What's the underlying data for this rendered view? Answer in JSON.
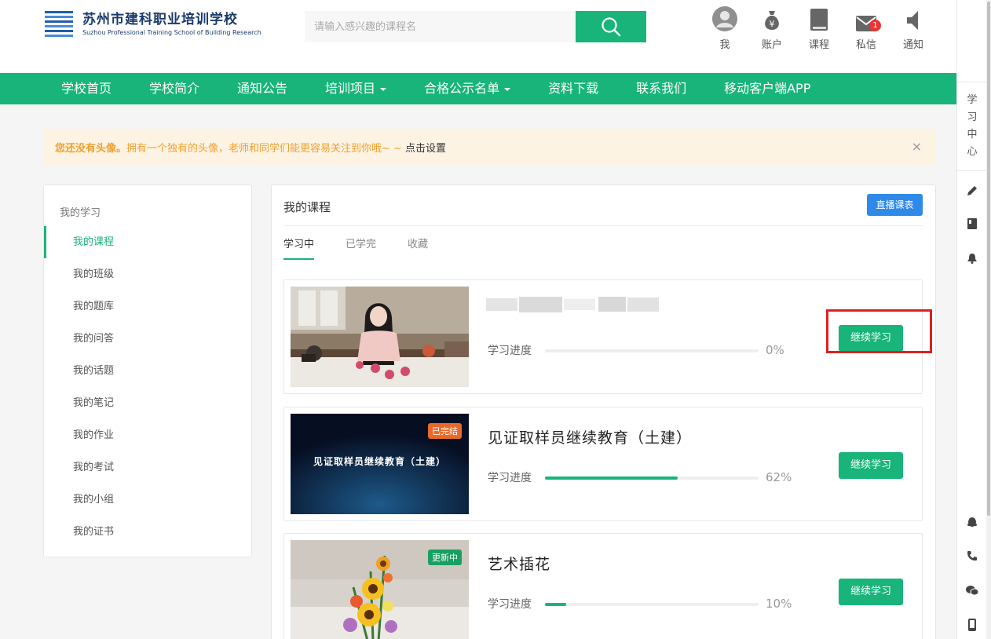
{
  "header": {
    "logo_cn": "苏州市建科职业培训学校",
    "logo_en": "Suzhou Professional Training School of Building Research",
    "search_placeholder": "请输入感兴趣的课程名",
    "icons": [
      {
        "label": "我",
        "icon": "avatar-icon"
      },
      {
        "label": "账户",
        "icon": "money-bag-icon"
      },
      {
        "label": "课程",
        "icon": "book-icon"
      },
      {
        "label": "私信",
        "icon": "mail-icon",
        "badge": "1"
      },
      {
        "label": "通知",
        "icon": "speaker-icon"
      }
    ]
  },
  "nav": {
    "items": [
      "学校首页",
      "学校简介",
      "通知公告",
      "培训项目",
      "合格公示名单",
      "资料下载",
      "联系我们",
      "移动客户端APP"
    ]
  },
  "alert": {
    "strong": "您还没有头像。",
    "message": "拥有一个独有的头像，老师和同学们能更容易关注到你哦~ ~",
    "link": "点击设置",
    "close": "×"
  },
  "sidebar": {
    "heading": "我的学习",
    "items": [
      "我的课程",
      "我的班级",
      "我的题库",
      "我的问答",
      "我的话题",
      "我的笔记",
      "我的作业",
      "我的考试",
      "我的小组",
      "我的证书"
    ]
  },
  "main": {
    "title": "我的课程",
    "live_button": "直播课表",
    "tabs": [
      "学习中",
      "已学完",
      "收藏"
    ],
    "progress_label": "学习进度",
    "continue_label": "继续学习",
    "courses": [
      {
        "title": "",
        "progress": 0,
        "progress_text": "0%",
        "tag": ""
      },
      {
        "title": "见证取样员继续教育（土建）",
        "progress": 62,
        "progress_text": "62%",
        "tag": "已完结",
        "thumb_text": "见证取样员继续教育（土建）"
      },
      {
        "title": "艺术插花",
        "progress": 10,
        "progress_text": "10%",
        "tag": "更新中"
      }
    ]
  },
  "rail": {
    "title": "学习中心"
  },
  "colors": {
    "primary": "#18b47a",
    "blue": "#2e89e8",
    "orange": "#f0a030",
    "highlight": "#e02020"
  }
}
